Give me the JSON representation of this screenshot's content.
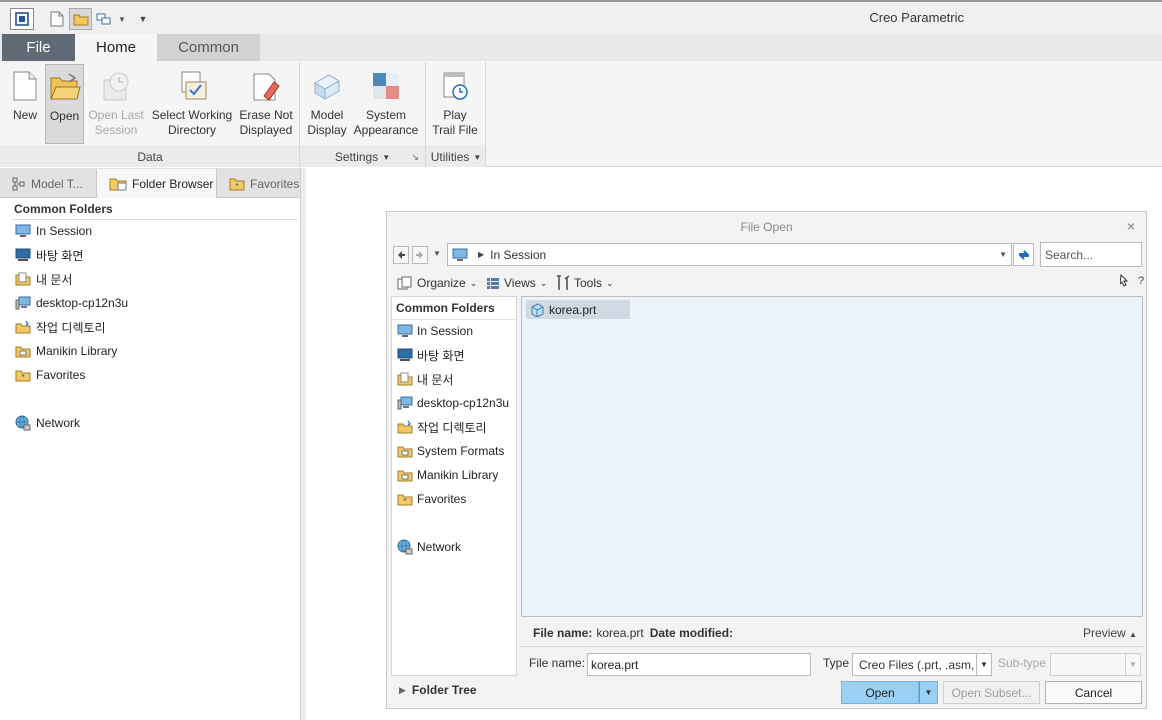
{
  "app": {
    "title": "Creo Parametric"
  },
  "ribbon_tabs": {
    "file": "File",
    "home": "Home",
    "common": "Common"
  },
  "ribbon": {
    "buttons": {
      "new": "New",
      "open": "Open",
      "open_last_1": "Open Last",
      "open_last_2": "Session",
      "select_wd_1": "Select Working",
      "select_wd_2": "Directory",
      "erase_1": "Erase Not",
      "erase_2": "Displayed",
      "model_display_1": "Model",
      "model_display_2": "Display",
      "system_app_1": "System",
      "system_app_2": "Appearance",
      "play_trail_1": "Play",
      "play_trail_2": "Trail File"
    },
    "groups": {
      "data": "Data",
      "settings": "Settings",
      "utilities": "Utilities"
    }
  },
  "navigator": {
    "tabs": {
      "model_tree": "Model T...",
      "folder_browser": "Folder Browser",
      "favorites": "Favorites"
    },
    "section_title": "Common Folders",
    "items": [
      "In Session",
      "바탕 화면",
      "내 문서",
      "desktop-cp12n3u",
      "작업 디렉토리",
      "Manikin Library",
      "Favorites"
    ],
    "network": "Network"
  },
  "dialog": {
    "title": "File Open",
    "close_glyph": "×",
    "path": "In Session",
    "search_placeholder": "Search...",
    "toolbar": {
      "organize": "Organize",
      "views": "Views",
      "tools": "Tools",
      "help": "?"
    },
    "nav": {
      "section_title": "Common Folders",
      "items": [
        "In Session",
        "바탕 화면",
        "내 문서",
        "desktop-cp12n3u",
        "작업 디렉토리",
        "System Formats",
        "Manikin Library",
        "Favorites"
      ],
      "network": "Network"
    },
    "files": [
      "korea.prt"
    ],
    "info": {
      "file_name_label": "File name:",
      "file_name_value": "korea.prt",
      "date_label": "Date modified:",
      "preview": "Preview"
    },
    "form": {
      "file_name_label": "File name:",
      "file_name_value": "korea.prt",
      "type_label": "Type",
      "type_value": "Creo Files (.prt, .asm,",
      "subtype_label": "Sub-type"
    },
    "folder_tree": "Folder Tree",
    "buttons": {
      "open": "Open",
      "open_subset": "Open Subset...",
      "cancel": "Cancel"
    }
  },
  "colors": {
    "file_tab": "#5f6a74",
    "open_button": "#9ad0f3",
    "file_list_bg": "#edf4f9",
    "selected_file": "#cfd9e3"
  }
}
